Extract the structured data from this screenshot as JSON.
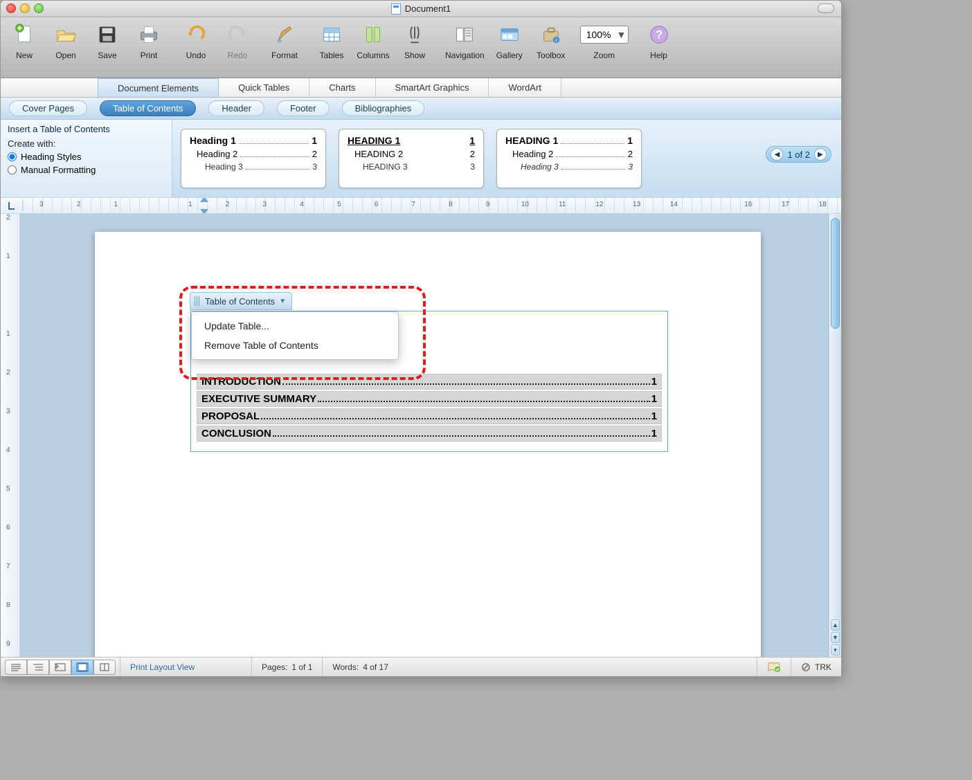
{
  "window": {
    "title": "Document1"
  },
  "toolbar": {
    "new": "New",
    "open": "Open",
    "save": "Save",
    "print": "Print",
    "undo": "Undo",
    "redo": "Redo",
    "format": "Format",
    "tables": "Tables",
    "columns": "Columns",
    "show": "Show",
    "navigation": "Navigation",
    "gallery": "Gallery",
    "toolbox": "Toolbox",
    "zoom_label": "Zoom",
    "zoom_value": "100%",
    "help": "Help"
  },
  "ribbon_tabs": {
    "doc_elements": "Document Elements",
    "quick_tables": "Quick Tables",
    "charts": "Charts",
    "smartart": "SmartArt Graphics",
    "wordart": "WordArt"
  },
  "categories": {
    "cover_pages": "Cover Pages",
    "toc": "Table of Contents",
    "header": "Header",
    "footer": "Footer",
    "bibliographies": "Bibliographies"
  },
  "options_panel": {
    "title": "Insert a Table of Contents",
    "create_with": "Create with:",
    "heading_styles": "Heading Styles",
    "manual_formatting": "Manual Formatting"
  },
  "gallery": {
    "cards": [
      {
        "h1": "Heading 1",
        "p1": "1",
        "h2": "Heading 2",
        "p2": "2",
        "h3": "Heading 3",
        "p3": "3",
        "style": "classic"
      },
      {
        "h1": "HEADING 1",
        "p1": "1",
        "h2": "HEADING 2",
        "p2": "2",
        "h3": "HEADING 3",
        "p3": "3",
        "style": "underline"
      },
      {
        "h1": "HEADING 1",
        "p1": "1",
        "h2": "Heading 2",
        "p2": "2",
        "h3": "Heading 3",
        "p3": "3",
        "style": "smallcaps"
      }
    ],
    "pager": "1 of 2"
  },
  "ruler": {
    "numbers": [
      "3",
      "2",
      "1",
      "",
      "1",
      "2",
      "3",
      "4",
      "5",
      "6",
      "7",
      "8",
      "9",
      "10",
      "11",
      "12",
      "13",
      "14",
      "",
      "16",
      "17",
      "18"
    ]
  },
  "vruler": {
    "numbers": [
      "2",
      "1",
      "",
      "1",
      "2",
      "3",
      "4",
      "5",
      "6",
      "7",
      "8",
      "9"
    ]
  },
  "toc_field": {
    "tab_label": "Table of Contents",
    "menu": {
      "update": "Update Table...",
      "remove": "Remove Table of Contents"
    },
    "entries": [
      {
        "title": "INTRODUCTION",
        "page": "1"
      },
      {
        "title": "EXECUTIVE SUMMARY",
        "page": "1"
      },
      {
        "title": "PROPOSAL",
        "page": "1"
      },
      {
        "title": "CONCLUSION",
        "page": "1"
      }
    ]
  },
  "status": {
    "view_name": "Print Layout View",
    "pages_label": "Pages:",
    "pages_value": "1 of 1",
    "words_label": "Words:",
    "words_value": "4 of 17",
    "spell": "",
    "trk": "TRK"
  }
}
